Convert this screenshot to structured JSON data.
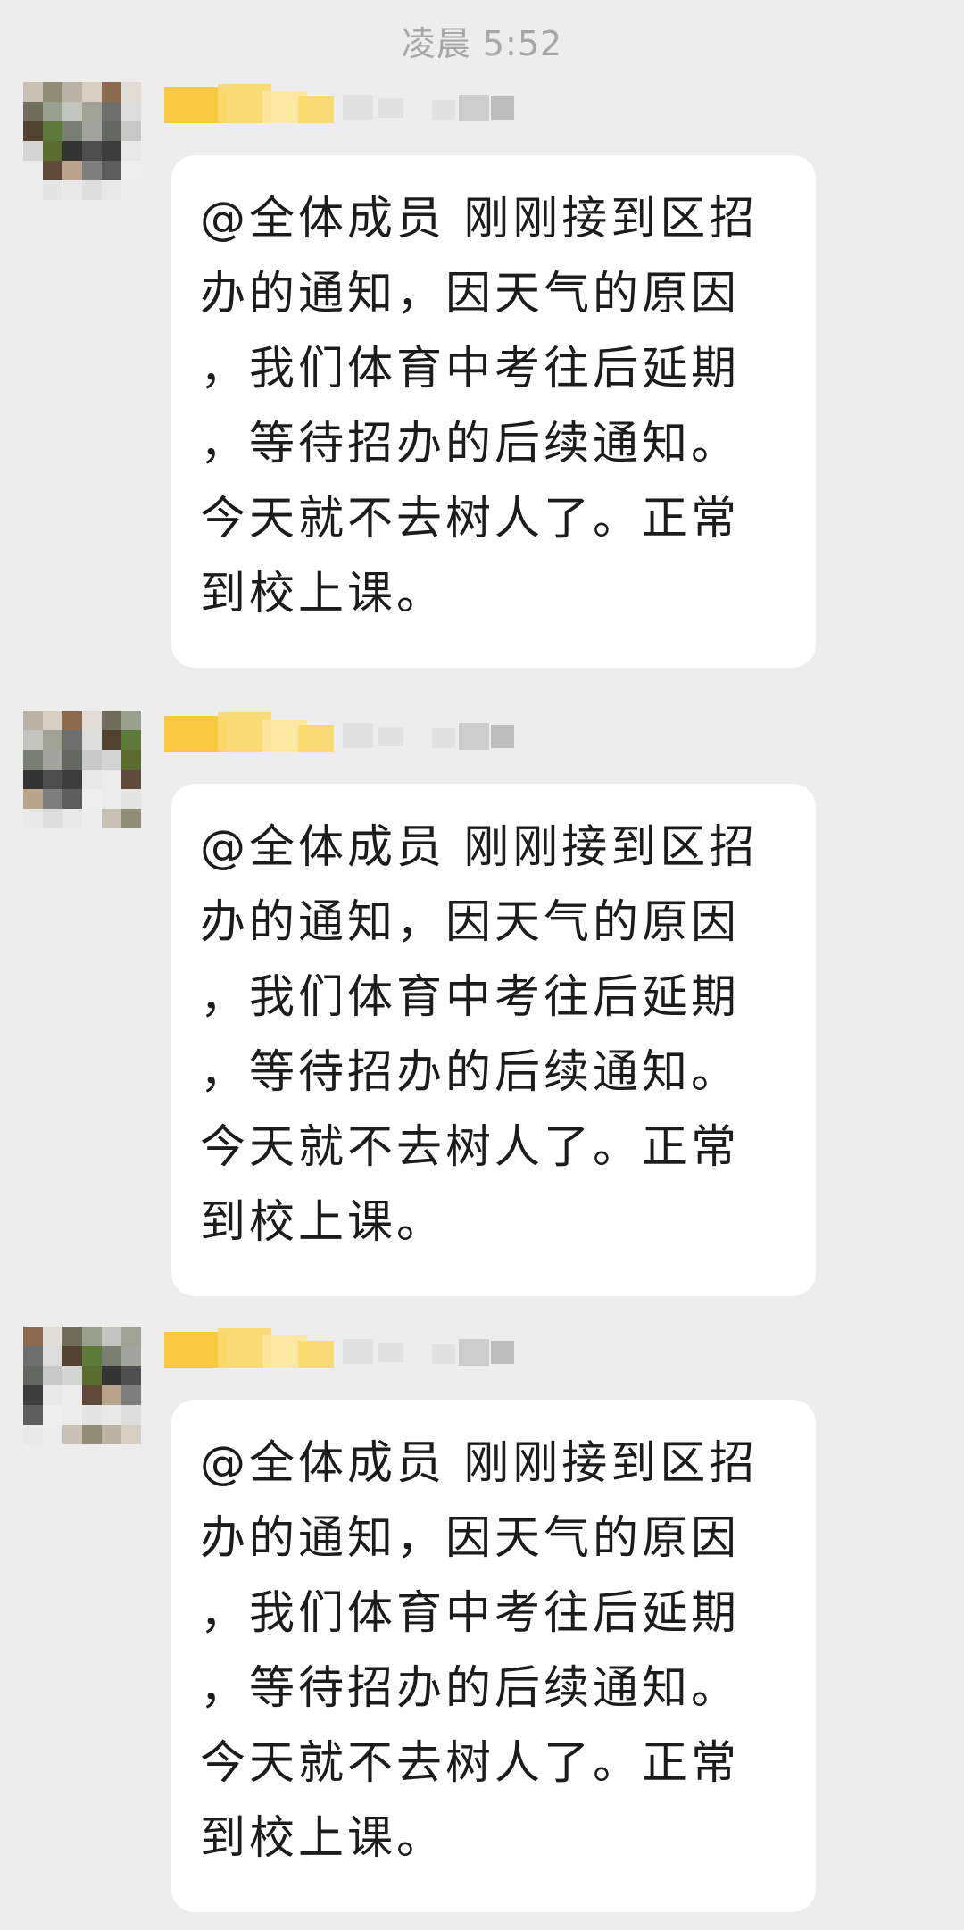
{
  "chat": {
    "timestamp": "凌晨 5:52",
    "messages": [
      {
        "lines": [
          "@全体成员 刚刚接到区招",
          "办的通知，因天气的原因",
          "，我们体育中考往后延期",
          "，等待招办的后续通知。",
          "今天就不去树人了。正常",
          "到校上课。"
        ]
      },
      {
        "lines": [
          "@全体成员 刚刚接到区招",
          "办的通知，因天气的原因",
          "，我们体育中考往后延期",
          "，等待招办的后续通知。",
          "今天就不去树人了。正常",
          "到校上课。"
        ]
      },
      {
        "lines": [
          "@全体成员 刚刚接到区招",
          "办的通知，因天气的原因",
          "，我们体育中考往后延期",
          "，等待招办的后续通知。",
          "今天就不去树人了。正常",
          "到校上课。"
        ]
      }
    ]
  },
  "avatar_palette": [
    "#c9c1b4",
    "#8f8d76",
    "#b9b3a6",
    "#d6cfc2",
    "#8b6a4e",
    "#e0ddd6",
    "#6f6e5c",
    "#9aa08e",
    "#c2c4bd",
    "#a0a295",
    "#6e6e6e",
    "#dcdcdc",
    "#514330",
    "#5e7a3b",
    "#7a7f73",
    "#a2a49d",
    "#646660",
    "#c8c8c8",
    "#d4d4d4",
    "#5b6c2f",
    "#343434",
    "#4e4e4e",
    "#3d3d3d",
    "#e8e8e8",
    "#ececec",
    "#604a3a",
    "#b9a58c",
    "#7e7e7e",
    "#5d5d5d",
    "#eeeeee",
    "#ececec",
    "#e4e4e4",
    "#e9e9e9",
    "#dedede",
    "#e8e8e8",
    "#ededed"
  ],
  "name_palette": [
    "#f8c637",
    "#fbd970",
    "#fde89f",
    "#d9d9d9",
    "#b8b8b8",
    "#9c9c9c"
  ]
}
